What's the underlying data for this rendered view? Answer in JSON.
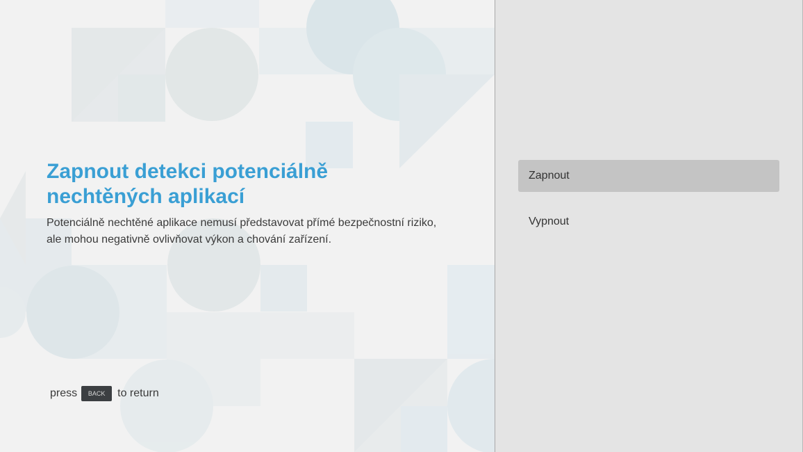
{
  "dialog": {
    "title": "Zapnout detekci potenciálně nechtěných aplikací",
    "description": "Potenciálně nechtěné aplikace nemusí představovat přímé bezpečnostní riziko, ale mohou negativně ovlivňovat výkon a chování zařízení."
  },
  "back_hint": {
    "prefix": "press",
    "key_label": "BACK",
    "suffix": "to return"
  },
  "options": [
    {
      "label": "Zapnout",
      "selected": true
    },
    {
      "label": "Vypnout",
      "selected": false
    }
  ],
  "colors": {
    "title": "#3a9fd4",
    "selected_option_bg": "#c4c4c4",
    "right_pane_bg": "#e4e4e4",
    "left_pane_bg": "#f2f2f2"
  }
}
